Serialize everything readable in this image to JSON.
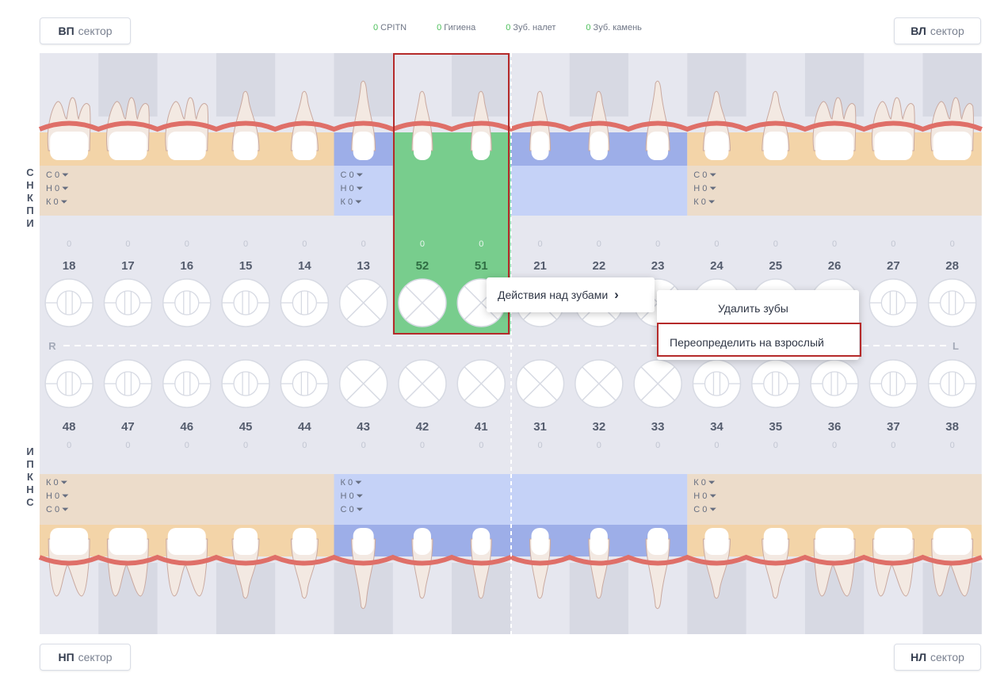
{
  "sectors": {
    "top_left": {
      "code": "ВП",
      "word": "сектор"
    },
    "top_right": {
      "code": "ВЛ",
      "word": "сектор"
    },
    "bottom_left": {
      "code": "НП",
      "word": "сектор"
    },
    "bottom_right": {
      "code": "НЛ",
      "word": "сектор"
    }
  },
  "stats": [
    {
      "value": "0",
      "label": "CPITN"
    },
    {
      "value": "0",
      "label": "Гигиена"
    },
    {
      "value": "0",
      "label": "Зуб. налет"
    },
    {
      "value": "0",
      "label": "Зуб. камень"
    }
  ],
  "side_labels": {
    "upper": [
      "С",
      "Н",
      "К",
      "П",
      "И"
    ],
    "lower": [
      "И",
      "П",
      "К",
      "Н",
      "С"
    ]
  },
  "upper_teeth": [
    {
      "num": "18",
      "score": "0",
      "kind": "molar",
      "cross": false
    },
    {
      "num": "17",
      "score": "0",
      "kind": "molar",
      "cross": false
    },
    {
      "num": "16",
      "score": "0",
      "kind": "molar",
      "cross": false
    },
    {
      "num": "15",
      "score": "0",
      "kind": "premolar",
      "cross": false
    },
    {
      "num": "14",
      "score": "0",
      "kind": "premolar",
      "cross": false
    },
    {
      "num": "13",
      "score": "0",
      "kind": "canine",
      "cross": true
    },
    {
      "num": "52",
      "score": "0",
      "kind": "incisor",
      "cross": true
    },
    {
      "num": "51",
      "score": "0",
      "kind": "incisor",
      "cross": true
    },
    {
      "num": "21",
      "score": "0",
      "kind": "incisor",
      "cross": true
    },
    {
      "num": "22",
      "score": "0",
      "kind": "incisor",
      "cross": true
    },
    {
      "num": "23",
      "score": "0",
      "kind": "canine",
      "cross": true
    },
    {
      "num": "24",
      "score": "0",
      "kind": "premolar",
      "cross": false
    },
    {
      "num": "25",
      "score": "0",
      "kind": "premolar",
      "cross": false
    },
    {
      "num": "26",
      "score": "0",
      "kind": "molar",
      "cross": false
    },
    {
      "num": "27",
      "score": "0",
      "kind": "molar",
      "cross": false
    },
    {
      "num": "28",
      "score": "0",
      "kind": "molar",
      "cross": false
    }
  ],
  "lower_teeth": [
    {
      "num": "48",
      "score": "0",
      "kind": "molar",
      "cross": false
    },
    {
      "num": "47",
      "score": "0",
      "kind": "molar",
      "cross": false
    },
    {
      "num": "46",
      "score": "0",
      "kind": "molar",
      "cross": false
    },
    {
      "num": "45",
      "score": "0",
      "kind": "premolar",
      "cross": false
    },
    {
      "num": "44",
      "score": "0",
      "kind": "premolar",
      "cross": false
    },
    {
      "num": "43",
      "score": "0",
      "kind": "canine",
      "cross": true
    },
    {
      "num": "42",
      "score": "0",
      "kind": "incisor",
      "cross": true
    },
    {
      "num": "41",
      "score": "0",
      "kind": "incisor",
      "cross": true
    },
    {
      "num": "31",
      "score": "0",
      "kind": "incisor",
      "cross": true
    },
    {
      "num": "32",
      "score": "0",
      "kind": "incisor",
      "cross": true
    },
    {
      "num": "33",
      "score": "0",
      "kind": "canine",
      "cross": true
    },
    {
      "num": "34",
      "score": "0",
      "kind": "premolar",
      "cross": false
    },
    {
      "num": "35",
      "score": "0",
      "kind": "premolar",
      "cross": false
    },
    {
      "num": "36",
      "score": "0",
      "kind": "molar",
      "cross": false
    },
    {
      "num": "37",
      "score": "0",
      "kind": "molar",
      "cross": false
    },
    {
      "num": "38",
      "score": "0",
      "kind": "molar",
      "cross": false
    }
  ],
  "upper_groups": [
    {
      "lines": [
        "С 0",
        "Н 0",
        "К 0"
      ],
      "tint": "orange"
    },
    {
      "lines": [
        "С 0",
        "Н 0",
        "К 0"
      ],
      "tint": "blue"
    },
    {
      "lines": [],
      "tint": "green"
    },
    {
      "lines": [],
      "tint": "blue"
    },
    {
      "lines": [
        "С 0",
        "Н 0",
        "К 0"
      ],
      "tint": "orange"
    }
  ],
  "lower_groups": [
    {
      "lines": [
        "К 0",
        "Н 0",
        "С 0"
      ],
      "tint": "orange"
    },
    {
      "lines": [
        "К 0",
        "Н 0",
        "С 0"
      ],
      "tint": "blue"
    },
    {
      "lines": [],
      "tint": "blue"
    },
    {
      "lines": [
        "К 0",
        "Н 0",
        "С 0"
      ],
      "tint": "orange"
    }
  ],
  "side_markers": {
    "right": "R",
    "left": "L"
  },
  "context_menu": {
    "actions_label": "Действия над зубами",
    "actions_arrow": "›",
    "items": [
      "Удалить зубы",
      "Переопределить на взрослый"
    ]
  },
  "selected_teeth": [
    "52",
    "51"
  ],
  "colors": {
    "selection": "#78cd8d",
    "highlight_border": "#b52a2a",
    "blue_tint": "#c5d2f7",
    "orange_tint": "#ecdcca",
    "gum": "#df6f68",
    "column_dark": "#d7d9e3",
    "column_light": "#e6e7ef"
  }
}
